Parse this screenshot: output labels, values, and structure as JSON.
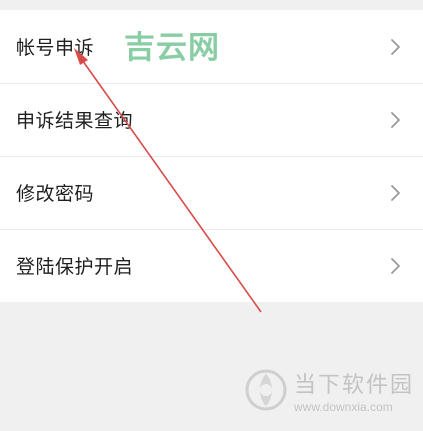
{
  "menu": {
    "items": [
      {
        "label": "帐号申诉"
      },
      {
        "label": "申诉结果查询"
      },
      {
        "label": "修改密码"
      },
      {
        "label": "登陆保护开启"
      }
    ]
  },
  "watermarks": {
    "top": "吉云网",
    "bottom_title": "当下软件园",
    "bottom_url": "www.downxia.com"
  },
  "colors": {
    "background": "#f0f0f0",
    "item_background": "#ffffff",
    "label": "#1f1f1f",
    "chevron": "#9a9a9a",
    "annotation_arrow": "#d94a4a"
  },
  "icons": {
    "chevron": "chevron-right-icon"
  }
}
